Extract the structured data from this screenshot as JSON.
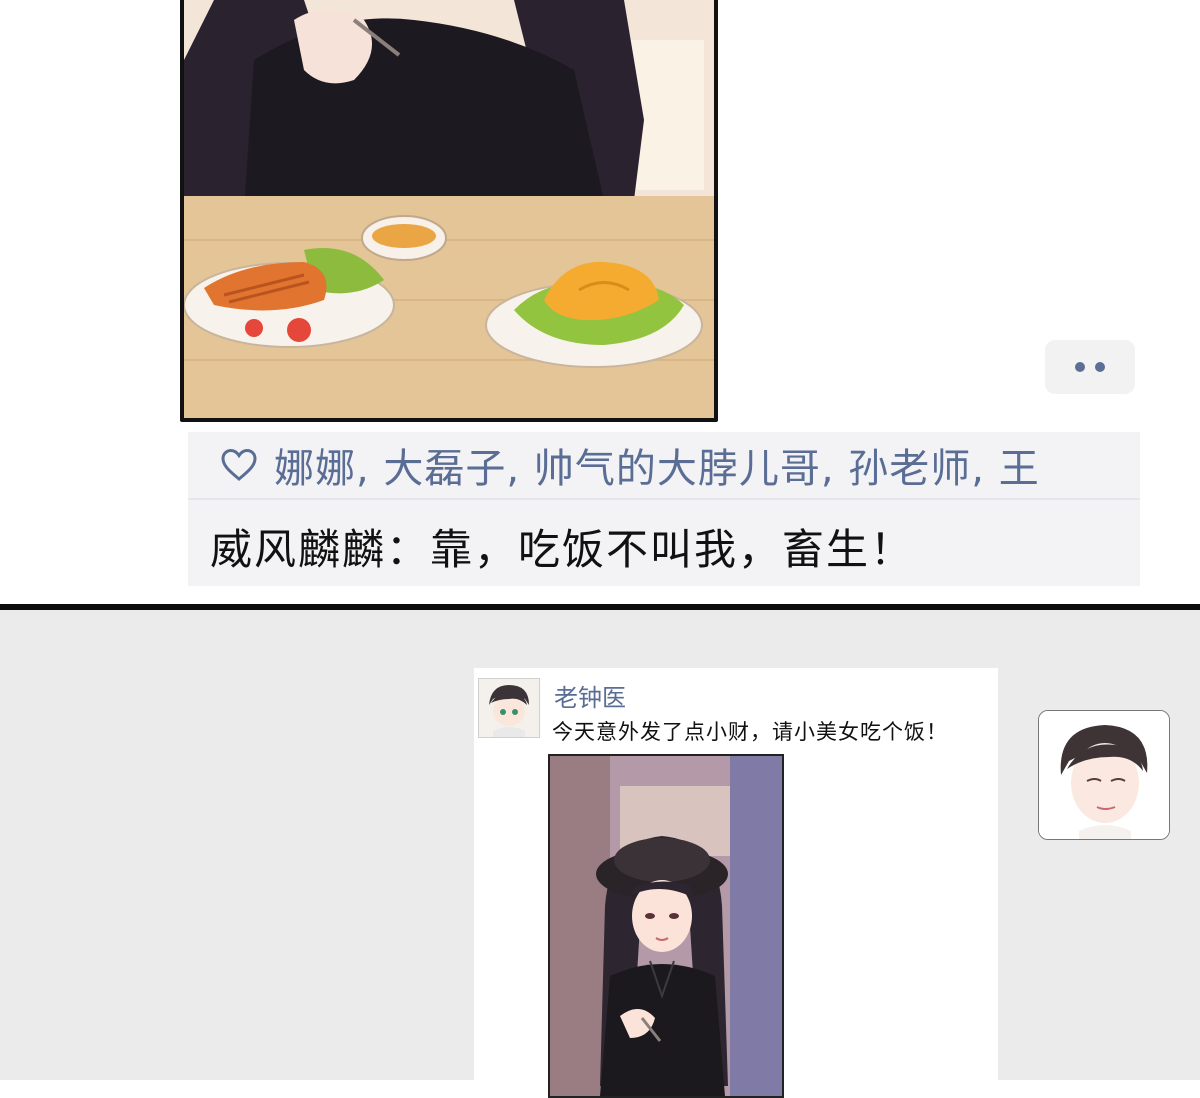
{
  "top_panel": {
    "likes": {
      "icon": "heart-outline-icon",
      "names_text": "娜娜, 大磊子, 帅气的大脖儿哥, 孙老师, 王"
    },
    "comment": {
      "author": "威风麟麟",
      "separator": "：",
      "text": "靠，吃饭不叫我，畜生！"
    },
    "more_button": {
      "icon": "more-dots-icon"
    },
    "colors": {
      "link_blue": "#5a6d95",
      "comment_bg": "#f3f3f5",
      "frame_border": "#111111"
    }
  },
  "bottom_panel": {
    "post": {
      "author": "老钟医",
      "text": "今天意外发了点小财，请小美女吃个饭！"
    },
    "colors": {
      "background": "#ebebeb",
      "card_bg": "#ffffff"
    }
  }
}
